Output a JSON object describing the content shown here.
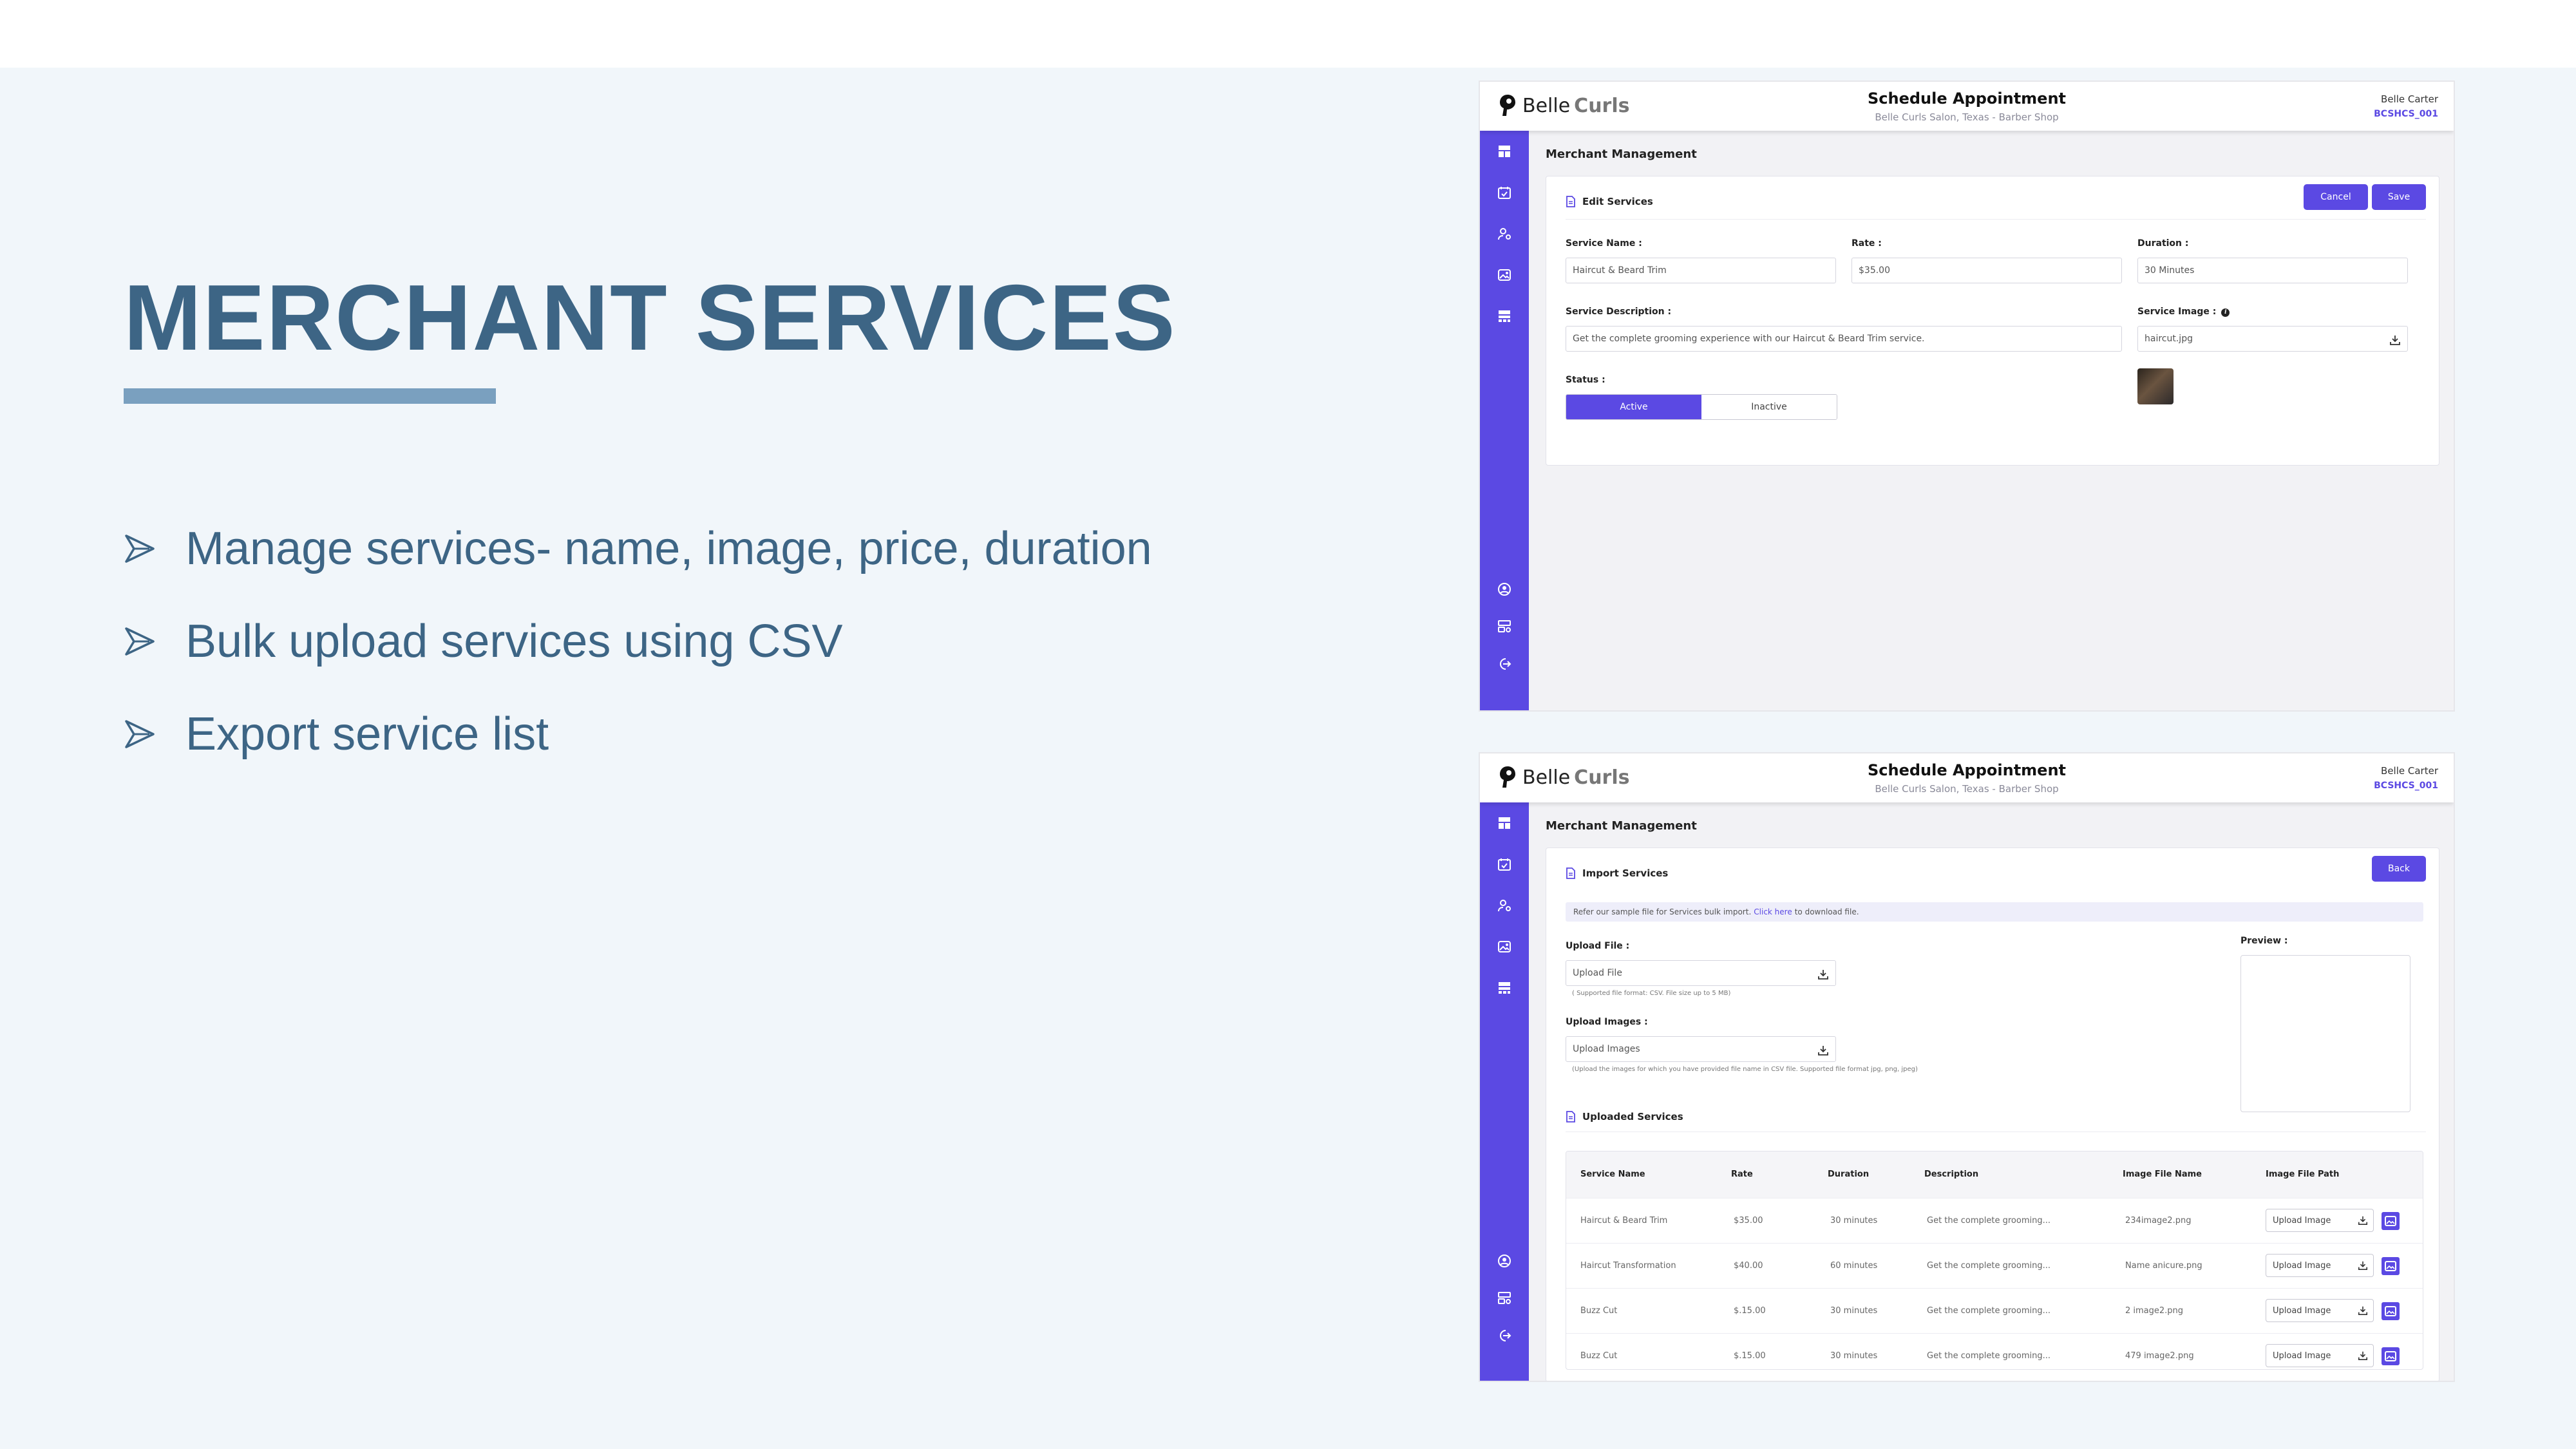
{
  "slide": {
    "title": "MERCHANT SERVICES",
    "bullets": [
      "Manage services- name, image, price, duration",
      "Bulk upload services using CSV",
      "Export service list"
    ]
  },
  "app": {
    "brand_main": "Belle",
    "brand_accent": "Curls",
    "page_title": "Schedule Appointment",
    "page_subtitle": "Belle Curls Salon, Texas - Barber Shop",
    "user_name": "Belle Carter",
    "user_code": "BCSHCS_001",
    "section_title": "Merchant Management",
    "sidebar_icons": [
      "dashboard-icon",
      "calendar-check-icon",
      "user-settings-icon",
      "gallery-icon",
      "services-icon",
      "profile-icon",
      "settings-icon",
      "logout-icon"
    ]
  },
  "edit": {
    "card_title": "Edit Services",
    "cancel_label": "Cancel",
    "save_label": "Save",
    "service_name_label": "Service Name :",
    "service_name_value": "Haircut & Beard Trim",
    "rate_label": "Rate :",
    "rate_value": "$35.00",
    "duration_label": "Duration :",
    "duration_value": "30 Minutes",
    "description_label": "Service Description :",
    "description_value": "Get the complete grooming experience with our Haircut & Beard Trim service.",
    "image_label": "Service Image :",
    "image_value": "haircut.jpg",
    "status_label": "Status :",
    "status_active": "Active",
    "status_inactive": "Inactive"
  },
  "import": {
    "card_title": "Import Services",
    "back_label": "Back",
    "banner_prefix": "Refer our sample file for Services bulk import.",
    "banner_link": "Click here",
    "banner_suffix": "to download file.",
    "upload_file_label": "Upload File :",
    "upload_file_placeholder": "Upload File",
    "upload_file_hint": "( Supported file format: CSV. File size up to 5 MB)",
    "upload_images_label": "Upload Images :",
    "upload_images_placeholder": "Upload Images",
    "upload_images_hint": "(Upload the images for which you have provided file name in CSV file. Supported file format jpg, png, jpeg)",
    "preview_label": "Preview :",
    "uploaded_title": "Uploaded Services",
    "columns": [
      "Service Name",
      "Rate",
      "Duration",
      "Description",
      "Image File Name",
      "Image File Path"
    ],
    "rows": [
      {
        "name": "Haircut & Beard Trim",
        "rate": "$35.00",
        "duration": "30 minutes",
        "description": "Get the complete grooming...",
        "file": "234image2.png",
        "action": "Upload Image"
      },
      {
        "name": "Haircut Transformation",
        "rate": "$40.00",
        "duration": "60 minutes",
        "description": "Get the complete grooming...",
        "file": "Name anicure.png",
        "action": "Upload Image"
      },
      {
        "name": "Buzz Cut",
        "rate": "$.15.00",
        "duration": "30 minutes",
        "description": "Get the complete grooming...",
        "file": "2 image2.png",
        "action": "Upload Image"
      },
      {
        "name": "Buzz Cut",
        "rate": "$.15.00",
        "duration": "30 minutes",
        "description": "Get the complete grooming...",
        "file": "479 image2.png",
        "action": "Upload Image"
      }
    ]
  },
  "colors": {
    "accent": "#5b49e3",
    "heading": "#3d6585",
    "bar": "#7aa0bf",
    "background": "#f1f6fa"
  }
}
